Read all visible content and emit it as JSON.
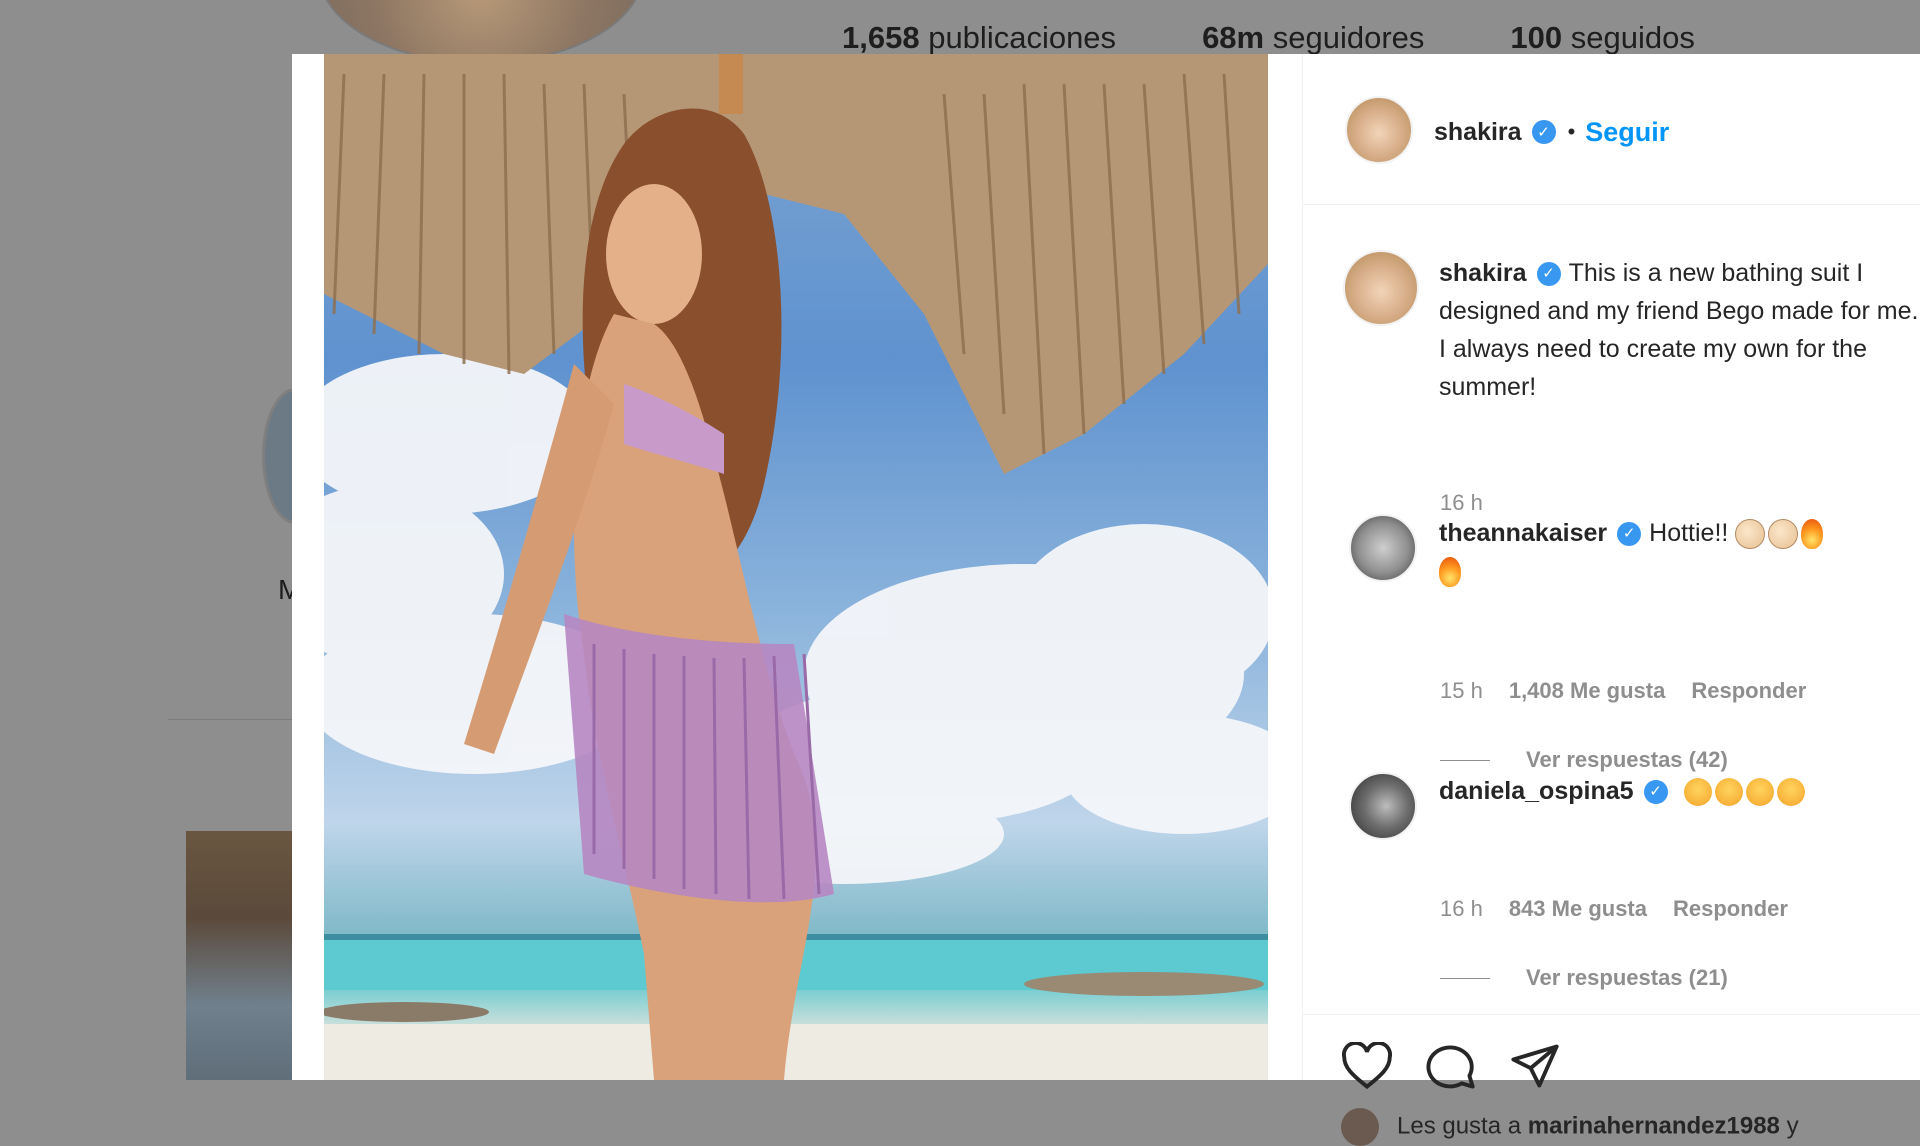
{
  "profile_background": {
    "stats": [
      {
        "count": "1,658",
        "label": "publicaciones"
      },
      {
        "count": "68m",
        "label": "seguidores"
      },
      {
        "count": "100",
        "label": "seguidos"
      }
    ],
    "highlight_label": "M"
  },
  "post": {
    "author": "shakira",
    "follow_label": "Seguir",
    "verified_icon": "verified-check-icon",
    "caption": "This is a new bathing suit I designed and my friend Bego made for me. I always need to create my own for the summer!",
    "caption_time": "16 h"
  },
  "comments": [
    {
      "username": "theannakaiser",
      "text": "Hottie!!",
      "emojis": [
        "clapping-hands-emoji",
        "clapping-hands-emoji",
        "fire-emoji",
        "fire-emoji"
      ],
      "time": "15 h",
      "likes": "1,408 Me gusta",
      "reply_label": "Responder",
      "view_replies": "Ver respuestas (42)"
    },
    {
      "username": "daniela_ospina5",
      "text": "",
      "emojis": [
        "smiling-face-with-hearts-emoji",
        "smiling-face-with-hearts-emoji",
        "smiling-face-with-hearts-emoji",
        "smiling-face-with-hearts-emoji"
      ],
      "time": "16 h",
      "likes": "843 Me gusta",
      "reply_label": "Responder",
      "view_replies": "Ver respuestas (21)"
    }
  ],
  "actions": {
    "icons": [
      "heart-icon",
      "comment-icon",
      "share-icon"
    ]
  },
  "liked_by": {
    "prefix": "Les gusta a",
    "user": "marinahernandez1988",
    "suffix": "y"
  },
  "colors": {
    "accent": "#0095f6",
    "verified": "#3897f0",
    "muted_text": "#8e8e8e",
    "overlay": "#8e8e8e"
  }
}
